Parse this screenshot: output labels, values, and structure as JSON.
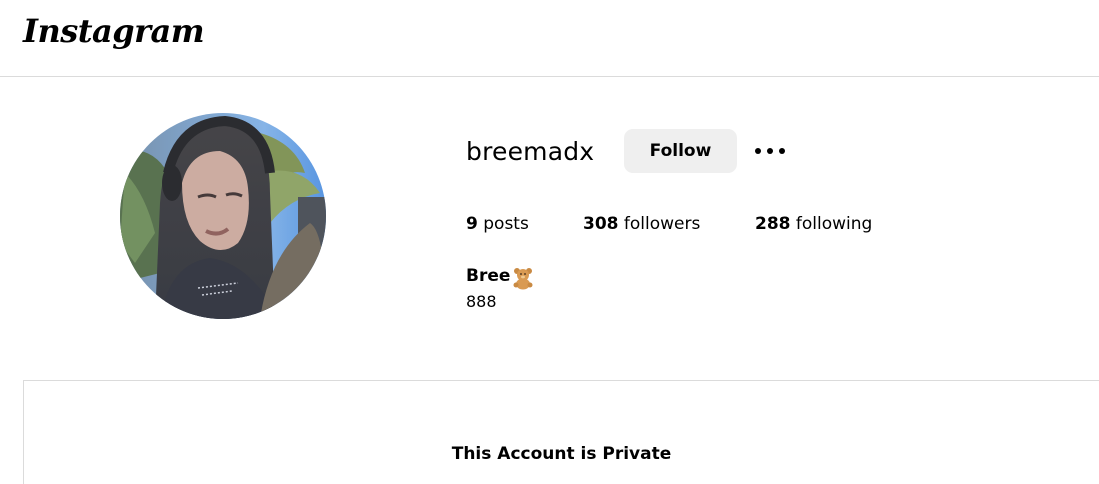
{
  "app": {
    "logo_text": "Instagram"
  },
  "profile": {
    "username": "breemadx",
    "follow_label": "Follow",
    "more_icon": "more-options-icon",
    "stats": {
      "posts_count": "9",
      "posts_label": " posts",
      "followers_count": "308",
      "followers_label": " followers",
      "following_count": "288",
      "following_label": " following"
    },
    "full_name": "Bree",
    "name_emoji": "teddy-bear-icon",
    "bio": "888"
  },
  "content": {
    "private_message": "This Account is Private"
  },
  "colors": {
    "follow_bg": "#efefef",
    "divider": "#dbdbdb",
    "text": "#000000"
  }
}
